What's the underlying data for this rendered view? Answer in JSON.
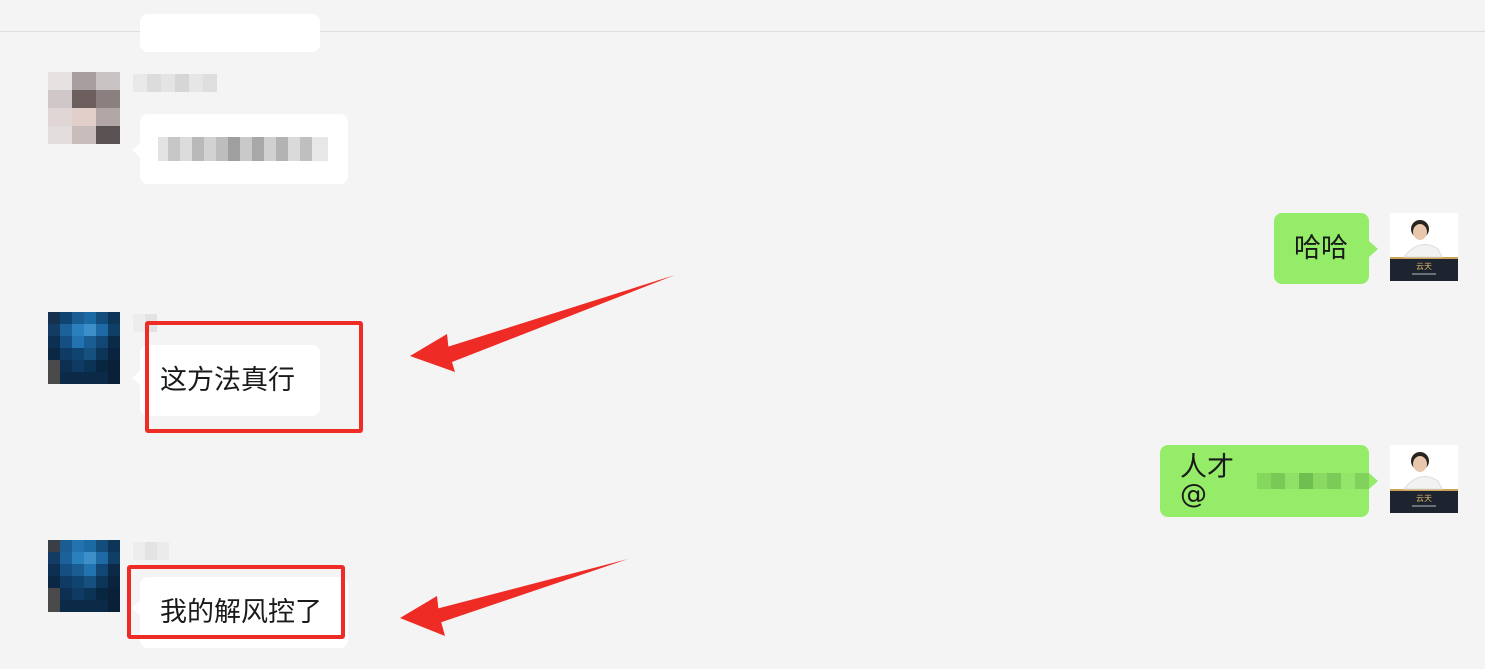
{
  "messages": [
    {
      "side": "incoming",
      "text": "",
      "redacted": true
    },
    {
      "side": "incoming",
      "text": "",
      "redacted": true
    },
    {
      "side": "outgoing",
      "text": "哈哈"
    },
    {
      "side": "incoming",
      "text": "这方法真行",
      "highlighted": true
    },
    {
      "side": "outgoing",
      "text": "人才@",
      "redacted_suffix": true
    },
    {
      "side": "incoming",
      "text": "我的解风控了",
      "highlighted": true
    }
  ],
  "self_avatar": {
    "caption": "云天"
  },
  "annotation_color": "#ee2b24",
  "colors": {
    "background": "#f4f4f4",
    "incoming_bubble": "#ffffff",
    "outgoing_bubble": "#95ec69"
  }
}
